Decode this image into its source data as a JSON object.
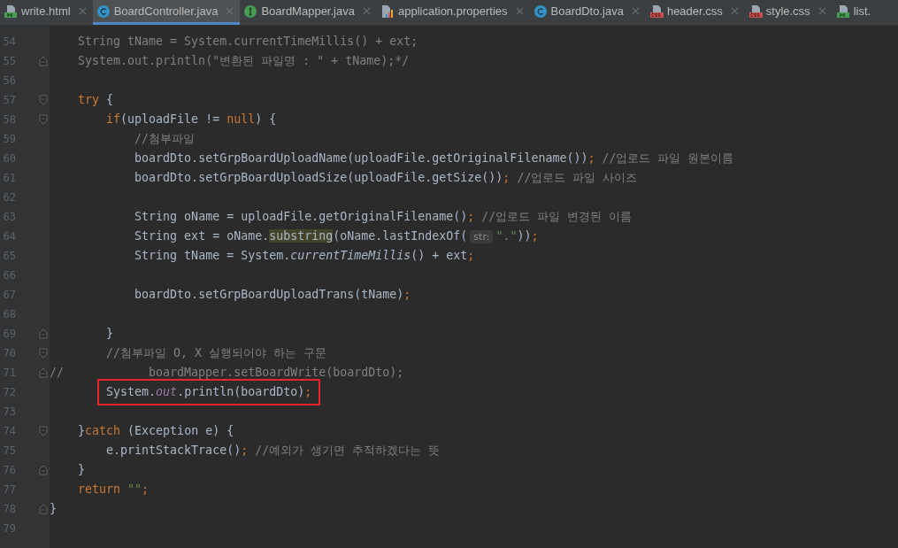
{
  "tabs": [
    {
      "label": "write.html",
      "kind": "html",
      "selected": false,
      "closable": true
    },
    {
      "label": "BoardController.java",
      "kind": "class",
      "selected": true,
      "closable": true
    },
    {
      "label": "BoardMapper.java",
      "kind": "interface",
      "selected": false,
      "closable": true
    },
    {
      "label": "application.properties",
      "kind": "properties",
      "selected": false,
      "closable": true
    },
    {
      "label": "BoardDto.java",
      "kind": "class",
      "selected": false,
      "closable": true
    },
    {
      "label": "header.css",
      "kind": "css",
      "selected": false,
      "closable": true
    },
    {
      "label": "style.css",
      "kind": "css",
      "selected": false,
      "closable": true
    },
    {
      "label": "list.",
      "kind": "html",
      "selected": false,
      "closable": false
    }
  ],
  "lines": [
    {
      "number": "54",
      "segments": [
        {
          "kind": "comment",
          "text": "    String tName = System.currentTimeMillis() + ext;"
        }
      ]
    },
    {
      "number": "55",
      "fold_end": true,
      "segments": [
        {
          "kind": "comment",
          "text": "    System.out.println(\"변환된 파일명 : \" + tName);*/"
        }
      ]
    },
    {
      "number": "56"
    },
    {
      "number": "57",
      "fold_start": true,
      "segments": [
        {
          "kind": "keyword",
          "text": "    try"
        },
        {
          "kind": "plain",
          "text": " {"
        }
      ]
    },
    {
      "number": "58",
      "fold_start": true,
      "segments": [
        {
          "kind": "keyword",
          "text": "        if"
        },
        {
          "kind": "plain",
          "text": "(uploadFile != "
        },
        {
          "kind": "keyword",
          "text": "null"
        },
        {
          "kind": "plain",
          "text": ") {"
        }
      ]
    },
    {
      "number": "59",
      "segments": [
        {
          "kind": "comment",
          "text": "            //첨부파일"
        }
      ]
    },
    {
      "number": "60",
      "segments": [
        {
          "kind": "plain",
          "text": "            boardDto.setGrpBoardUploadName(uploadFile.getOriginalFilename())"
        },
        {
          "kind": "punct",
          "text": ";"
        },
        {
          "kind": "comment",
          "text": " //업로드 파일 원본이름"
        }
      ]
    },
    {
      "number": "61",
      "segments": [
        {
          "kind": "plain",
          "text": "            boardDto.setGrpBoardUploadSize(uploadFile.getSize())"
        },
        {
          "kind": "punct",
          "text": ";"
        },
        {
          "kind": "comment",
          "text": " //업로드 파일 사이즈"
        }
      ]
    },
    {
      "number": "62"
    },
    {
      "number": "63",
      "segments": [
        {
          "kind": "plain",
          "text": "            String oName = uploadFile.getOriginalFilename()"
        },
        {
          "kind": "punct",
          "text": ";"
        },
        {
          "kind": "comment",
          "text": " //업로드 파일 변경된 이름"
        }
      ]
    },
    {
      "number": "64",
      "segments": [
        {
          "kind": "plain",
          "text": "            String ext = oName."
        },
        {
          "kind": "match",
          "text": "substring"
        },
        {
          "kind": "plain",
          "text": "(oName.lastIndexOf("
        },
        {
          "kind": "hint",
          "text": "str:"
        },
        {
          "kind": "string",
          "text": "\".\""
        },
        {
          "kind": "plain",
          "text": "))"
        },
        {
          "kind": "punct",
          "text": ";"
        }
      ]
    },
    {
      "number": "65",
      "segments": [
        {
          "kind": "plain",
          "text": "            String tName = System."
        },
        {
          "kind": "static",
          "text": "currentTimeMillis"
        },
        {
          "kind": "plain",
          "text": "() + ext"
        },
        {
          "kind": "punct",
          "text": ";"
        }
      ]
    },
    {
      "number": "66"
    },
    {
      "number": "67",
      "segments": [
        {
          "kind": "plain",
          "text": "            boardDto.setGrpBoardUploadTrans(tName)"
        },
        {
          "kind": "punct",
          "text": ";"
        }
      ]
    },
    {
      "number": "68"
    },
    {
      "number": "69",
      "fold_end": true,
      "segments": [
        {
          "kind": "plain",
          "text": "        }"
        }
      ]
    },
    {
      "number": "70",
      "fold_start": true,
      "segments": [
        {
          "kind": "comment",
          "text": "        //첨부파일 O, X 실행되어야 하는 구문"
        }
      ]
    },
    {
      "number": "71",
      "fold_end": true,
      "segments": [
        {
          "kind": "comment",
          "text": "//            boardMapper.setBoardWrite(boardDto);"
        }
      ]
    },
    {
      "number": "72",
      "boxed": true,
      "segments": [
        {
          "kind": "plain",
          "text": "        System."
        },
        {
          "kind": "field",
          "text": "out"
        },
        {
          "kind": "plain",
          "text": ".println(boardDto)"
        },
        {
          "kind": "punct",
          "text": ";"
        }
      ]
    },
    {
      "number": "73"
    },
    {
      "number": "74",
      "fold_start": true,
      "segments": [
        {
          "kind": "plain",
          "text": "    }"
        },
        {
          "kind": "keyword",
          "text": "catch"
        },
        {
          "kind": "plain",
          "text": " (Exception e) {"
        }
      ]
    },
    {
      "number": "75",
      "segments": [
        {
          "kind": "plain",
          "text": "        e.printStackTrace()"
        },
        {
          "kind": "punct",
          "text": ";"
        },
        {
          "kind": "comment",
          "text": " //예외가 생기면 추적하겠다는 뜻"
        }
      ]
    },
    {
      "number": "76",
      "fold_end": true,
      "segments": [
        {
          "kind": "plain",
          "text": "    }"
        }
      ]
    },
    {
      "number": "77",
      "segments": [
        {
          "kind": "keyword",
          "text": "    return"
        },
        {
          "kind": "string",
          "text": " \"\""
        },
        {
          "kind": "punct",
          "text": ";"
        }
      ]
    },
    {
      "number": "78",
      "fold_end": true,
      "segments": [
        {
          "kind": "plain",
          "text": "}"
        }
      ]
    },
    {
      "number": "79"
    }
  ]
}
